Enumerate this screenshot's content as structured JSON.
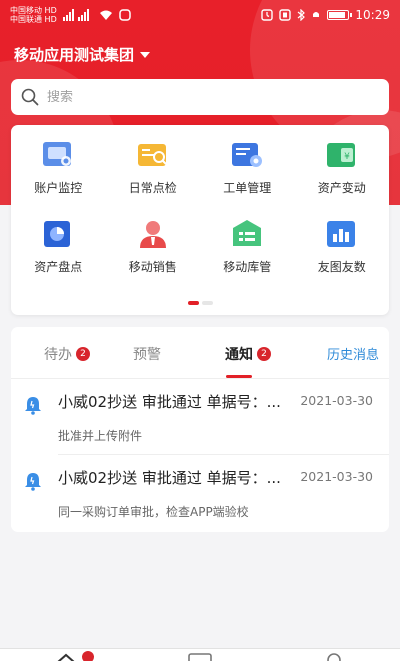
{
  "status_bar": {
    "carrier_1": "中国移动",
    "carrier_1_tag": "HD",
    "carrier_2": "中国联通",
    "carrier_2_tag": "HD",
    "time": "10:29",
    "battery_level": 0.9
  },
  "header": {
    "org_name": "移动应用测试集团"
  },
  "search": {
    "placeholder": "搜索"
  },
  "apps": [
    {
      "label": "账户监控",
      "icon": "account-monitor-icon"
    },
    {
      "label": "日常点检",
      "icon": "daily-inspection-icon"
    },
    {
      "label": "工单管理",
      "icon": "work-order-icon"
    },
    {
      "label": "资产变动",
      "icon": "asset-change-icon"
    },
    {
      "label": "资产盘点",
      "icon": "asset-inventory-icon"
    },
    {
      "label": "移动销售",
      "icon": "mobile-sales-icon"
    },
    {
      "label": "移动库管",
      "icon": "mobile-warehouse-icon"
    },
    {
      "label": "友图友数",
      "icon": "chart-data-icon"
    }
  ],
  "pager": {
    "pages": 2,
    "current": 1
  },
  "tabs": [
    {
      "label": "待办",
      "badge": "2"
    },
    {
      "label": "预警",
      "badge": ""
    },
    {
      "label": "通知",
      "badge": "2",
      "active": true
    }
  ],
  "history_link": "历史消息",
  "messages": [
    {
      "title": "小威02抄送  审批通过 单据号：...",
      "date": "2021-03-30",
      "desc": "批准并上传附件"
    },
    {
      "title": "小威02抄送  审批通过 单据号：...",
      "date": "2021-03-30",
      "desc": "同一采购订单审批，检查APP端验校"
    }
  ],
  "colors": {
    "brand_red": "#e41f28",
    "badge_red": "#d8252c",
    "link_blue": "#2f8bd8",
    "bell_blue": "#3a8ee6"
  }
}
